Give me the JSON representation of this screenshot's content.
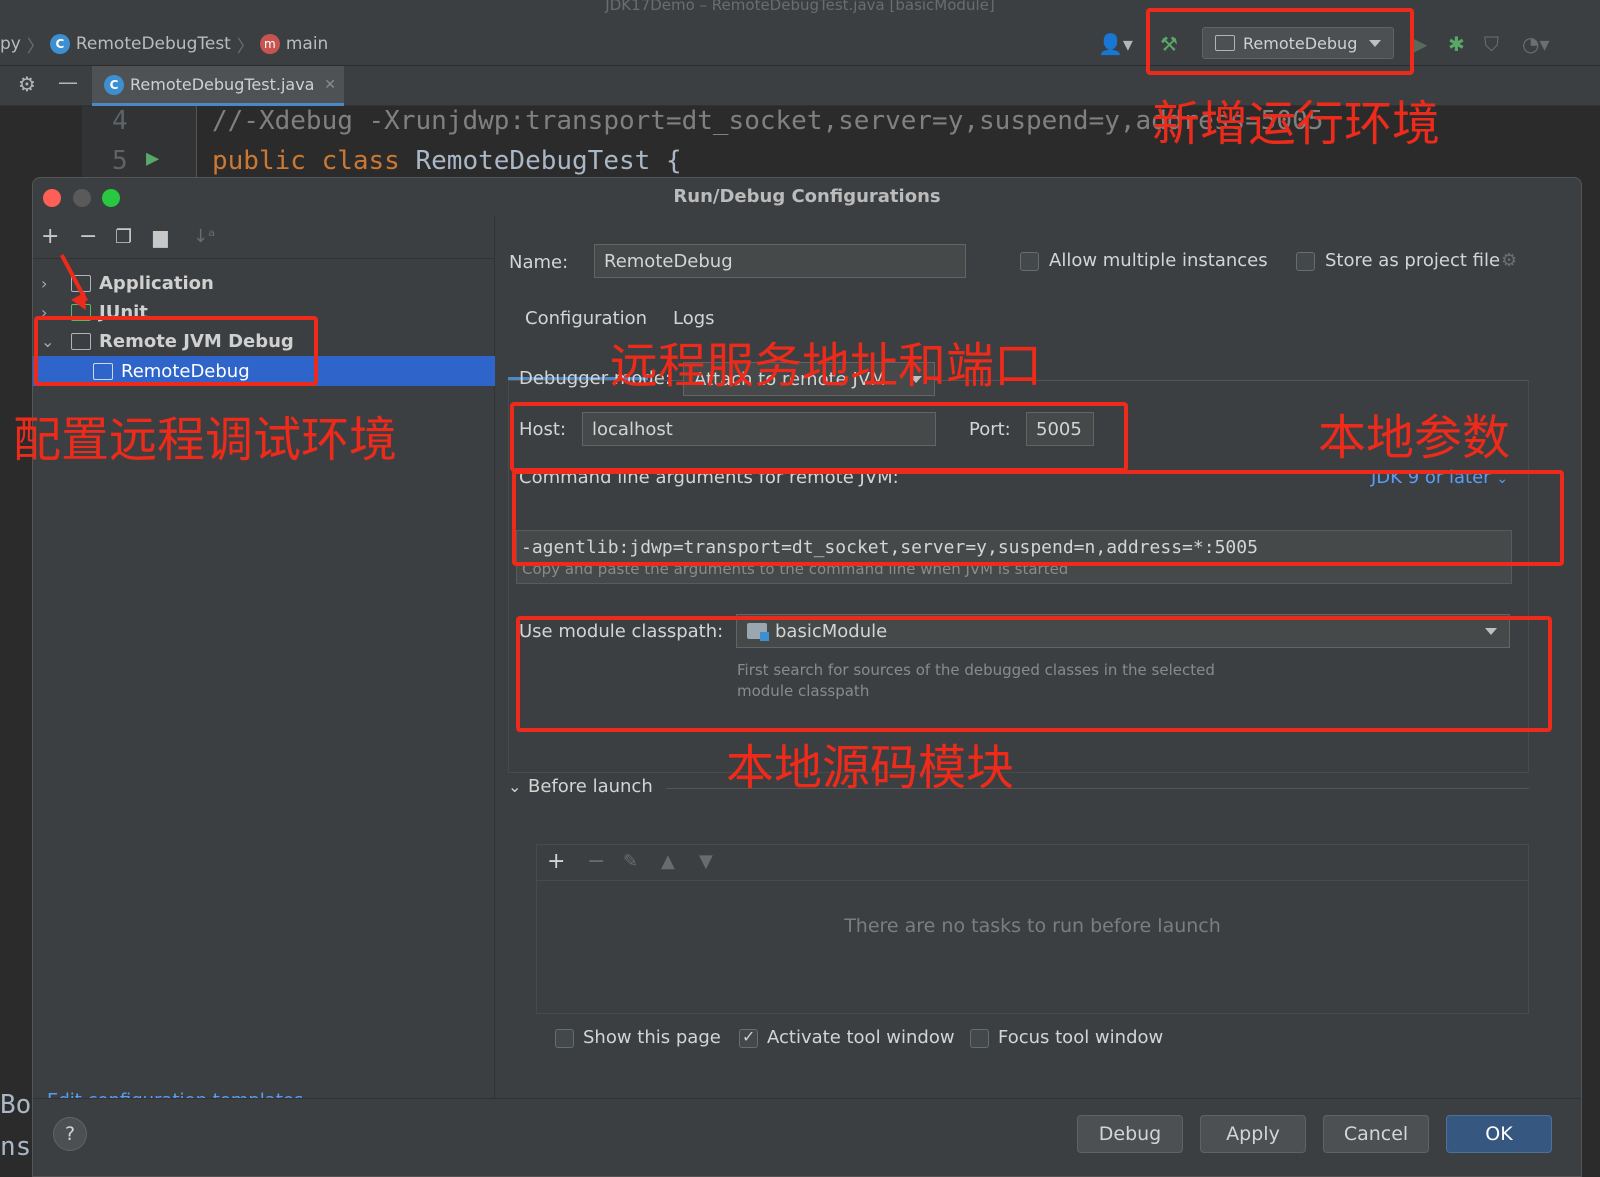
{
  "ide": {
    "window_title": "JDK17Demo – RemoteDebugTest.java [basicModule]",
    "breadcrumb_prefix": "py",
    "breadcrumb_class": "RemoteDebugTest",
    "breadcrumb_method": "main",
    "run_config": "RemoteDebug",
    "file_tab": "RemoteDebugTest.java",
    "code_lines": [
      {
        "num": "4",
        "text": "//-Xdebug -Xrunjdwp:transport=dt_socket,server=y,suspend=y,address=5005"
      },
      {
        "num": "5",
        "kw": "public class",
        "cls": "RemoteDebugTest {"
      }
    ],
    "bg_left_text_1": "Bo",
    "bg_left_text_2": "ns"
  },
  "dialog": {
    "title": "Run/Debug Configurations",
    "tree": [
      {
        "label": "Application"
      },
      {
        "label": "JUnit"
      },
      {
        "label": "Remote JVM Debug"
      },
      {
        "label": "RemoteDebug"
      }
    ],
    "edit_templates": "Edit configuration templates…",
    "name_label": "Name:",
    "name_value": "RemoteDebug",
    "allow_multiple": "Allow multiple instances",
    "store_project": "Store as project file",
    "tabs": [
      "Configuration",
      "Logs"
    ],
    "debugger_mode_label": "Debugger mode:",
    "debugger_mode_value": "Attach to remote JVM",
    "host_label": "Host:",
    "host_value": "localhost",
    "port_label": "Port:",
    "port_value": "5005",
    "cmd_label": "Command line arguments for remote JVM:",
    "jdk_version": "JDK 9 or later",
    "cmd_value": "-agentlib:jdwp=transport=dt_socket,server=y,suspend=n,address=*:5005",
    "cmd_hint": "Copy and paste the arguments to the command line when JVM is started",
    "module_label": "Use module classpath:",
    "module_value": "basicModule",
    "module_hint_1": "First search for sources of the debugged classes in the selected",
    "module_hint_2": "module classpath",
    "before_launch": "Before launch",
    "no_tasks": "There are no tasks to run before launch",
    "show_page": "Show this page",
    "activate_tool": "Activate tool window",
    "focus_tool": "Focus tool window",
    "buttons": {
      "debug": "Debug",
      "apply": "Apply",
      "cancel": "Cancel",
      "ok": "OK"
    },
    "help": "?"
  },
  "annotations": {
    "add_env": "新增运行环境",
    "remote_addr": "远程服务地址和端口",
    "config_remote": "配置远程调试环境",
    "local_params": "本地参数",
    "local_module": "本地源码模块"
  },
  "colors": {
    "accent_red": "#ee2b1a",
    "selection": "#2f65ca",
    "link": "#589df6"
  }
}
